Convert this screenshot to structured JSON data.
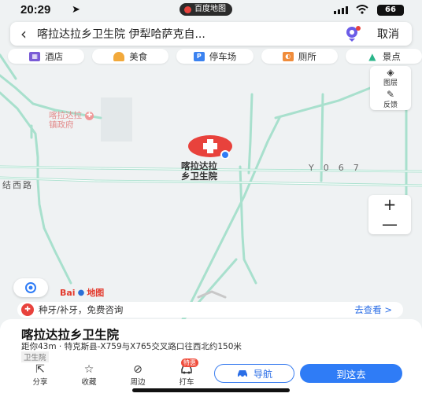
{
  "status_bar": {
    "time": "20:29",
    "location_arrow": "➤",
    "app_pill": "百度地图",
    "battery": "66"
  },
  "search": {
    "back_icon": "‹",
    "query": "喀拉达拉乡卫生院 伊犁哈萨克自...",
    "cancel": "取消"
  },
  "categories": [
    {
      "label": "酒店",
      "icon": "hotel-icon",
      "color": "#7a5bd6"
    },
    {
      "label": "美食",
      "icon": "food-icon",
      "color": "#f2a93b"
    },
    {
      "label": "停车场",
      "icon": "parking-icon",
      "color": "#3b82f0",
      "glyph": "P"
    },
    {
      "label": "厕所",
      "icon": "toilet-icon",
      "color": "#f08c3b"
    },
    {
      "label": "景点",
      "icon": "scenic-icon",
      "color": "#2bb58a"
    }
  ],
  "right_panel": {
    "layers": "图层",
    "feedback": "反馈"
  },
  "zoom": {
    "in": "+",
    "out": "—"
  },
  "map": {
    "gov_label_line1": "喀拉达拉",
    "gov_label_line2": "镇政府",
    "hospital_line1": "喀拉达拉",
    "hospital_line2": "乡卫生院",
    "road_label": "Y067",
    "street_label": "结西路"
  },
  "logo": {
    "text": "Bai",
    "suffix": "地图"
  },
  "ad": {
    "text": "种牙/补牙，免费咨询",
    "link": "去查看 >"
  },
  "poi": {
    "title": "喀拉达拉乡卫生院",
    "distance": "距你43m · 特克斯县-X759与X765交叉路口往西北约150米",
    "category": "卫生院"
  },
  "actions": [
    {
      "label": "分享",
      "icon": "share-icon",
      "glyph": "⇱"
    },
    {
      "label": "收藏",
      "icon": "star-icon",
      "glyph": "☆"
    },
    {
      "label": "周边",
      "icon": "nearby-icon",
      "glyph": "⊘"
    },
    {
      "label": "打车",
      "icon": "taxi-icon",
      "glyph": "🚖",
      "badge": "特惠"
    }
  ],
  "nav_button": "导航",
  "go_button": "到这去",
  "colors": {
    "accent": "#2f7cf6",
    "marker": "#e8423c",
    "road_green": "#a8e0cd"
  }
}
